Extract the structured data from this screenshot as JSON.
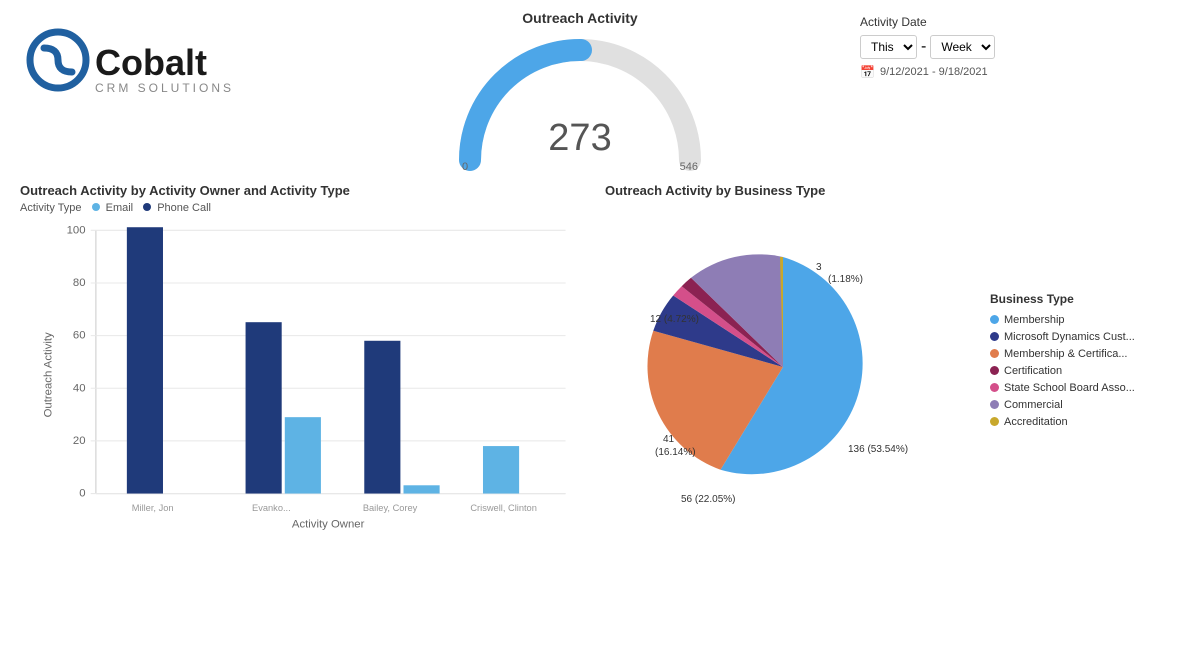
{
  "logo": {
    "alt": "Cobalt CRM Solutions"
  },
  "outreach_activity": {
    "title": "Outreach Activity",
    "value": 273,
    "min": 0,
    "max": 546
  },
  "activity_date": {
    "label": "Activity Date",
    "this_label": "This",
    "separator": "-",
    "week_label": "Week",
    "date_range": "9/12/2021 - 9/18/2021"
  },
  "bar_chart": {
    "title": "Outreach Activity by Activity Owner and Activity Type",
    "legend_label": "Activity Type",
    "legend_items": [
      {
        "label": "Email",
        "color": "#5eb3e4"
      },
      {
        "label": "Phone Call",
        "color": "#1f3a7a"
      }
    ],
    "y_axis_label": "Outreach Activity",
    "x_axis_label": "Activity Owner",
    "y_ticks": [
      0,
      20,
      40,
      60,
      80,
      100
    ],
    "bars": [
      {
        "owner": "Miller, Jon",
        "email": 0,
        "phone": 101
      },
      {
        "owner": "Evanko...",
        "email": 29,
        "phone": 65
      },
      {
        "owner": "Bailey, Corey",
        "email": 3,
        "phone": 58
      },
      {
        "owner": "Criswell, Clinton",
        "email": 18,
        "phone": 0
      }
    ]
  },
  "pie_chart": {
    "title": "Outreach Activity by Business Type",
    "segments": [
      {
        "label": "Membership",
        "value": 136,
        "pct": "53.54%",
        "color": "#4da6e8"
      },
      {
        "label": "Membership & Certifica...",
        "value": 41,
        "pct": "16.14%",
        "color": "#e07c4c"
      },
      {
        "label": "Microsoft Dynamics Cust...",
        "value": 12,
        "pct": "4.72%",
        "color": "#2e3a8a"
      },
      {
        "label": "State School Board Asso...",
        "value": 3,
        "pct": "1.18%",
        "color": "#d44f8a"
      },
      {
        "label": "Certification",
        "value": 3,
        "pct": "1.18%",
        "color": "#8b2252"
      },
      {
        "label": "Commercial",
        "value": 56,
        "pct": "22.05%",
        "color": "#8e7db5"
      },
      {
        "label": "Accreditation",
        "value": 3,
        "pct": "1.18%",
        "color": "#c8a82c"
      }
    ],
    "legend_title": "Business Type"
  }
}
